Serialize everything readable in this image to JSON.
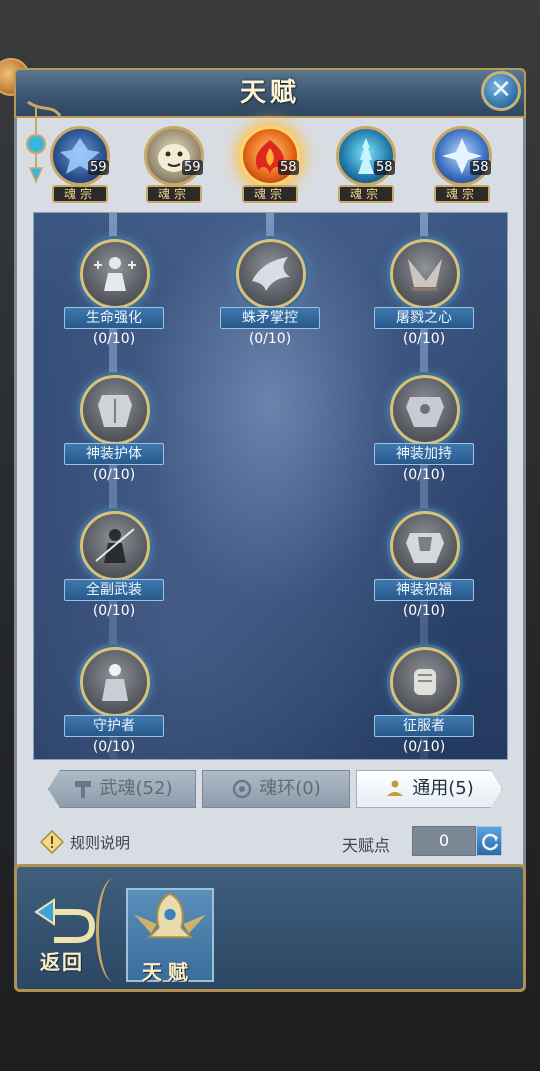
{
  "window": {
    "title": "天赋",
    "close_icon": "close-icon"
  },
  "heroes": [
    {
      "tag": "魂宗",
      "level": "59",
      "icon": "ice-spirit-icon",
      "selected": false
    },
    {
      "tag": "魂宗",
      "level": "59",
      "icon": "tiger-spirit-icon",
      "selected": false
    },
    {
      "tag": "魂宗",
      "level": "58",
      "icon": "phoenix-spirit-icon",
      "selected": true
    },
    {
      "tag": "魂宗",
      "level": "58",
      "icon": "tower-spirit-icon",
      "selected": false
    },
    {
      "tag": "魂宗",
      "level": "58",
      "icon": "crystal-spirit-icon",
      "selected": false
    }
  ],
  "talents": [
    {
      "name": "生命强化",
      "progress": "(0/10)",
      "icon": "life-boost-icon"
    },
    {
      "name": "蛛矛掌控",
      "progress": "(0/10)",
      "icon": "spider-spear-icon"
    },
    {
      "name": "屠戮之心",
      "progress": "(0/10)",
      "icon": "slaughter-heart-icon"
    },
    {
      "name": "神装护体",
      "progress": "(0/10)",
      "icon": "armor-guard-icon"
    },
    {
      "name": "神装加持",
      "progress": "(0/10)",
      "icon": "armor-empower-icon"
    },
    {
      "name": "全副武装",
      "progress": "(0/10)",
      "icon": "full-armed-icon"
    },
    {
      "name": "神装祝福",
      "progress": "(0/10)",
      "icon": "armor-bless-icon"
    },
    {
      "name": "守护者",
      "progress": "(0/10)",
      "icon": "guardian-icon"
    },
    {
      "name": "征服者",
      "progress": "(0/10)",
      "icon": "conqueror-icon"
    }
  ],
  "tabs": [
    {
      "label": "武魂(52)",
      "icon": "hammer-icon",
      "active": false
    },
    {
      "label": "魂环(0)",
      "icon": "soul-ring-icon",
      "active": false
    },
    {
      "label": "通用(5)",
      "icon": "meditate-icon",
      "active": true
    }
  ],
  "footer": {
    "rules_label": "规则说明",
    "points_label": "天赋点",
    "points_value": "0"
  },
  "bottom_bar": {
    "back_label": "返回",
    "talent_label": "天赋"
  }
}
